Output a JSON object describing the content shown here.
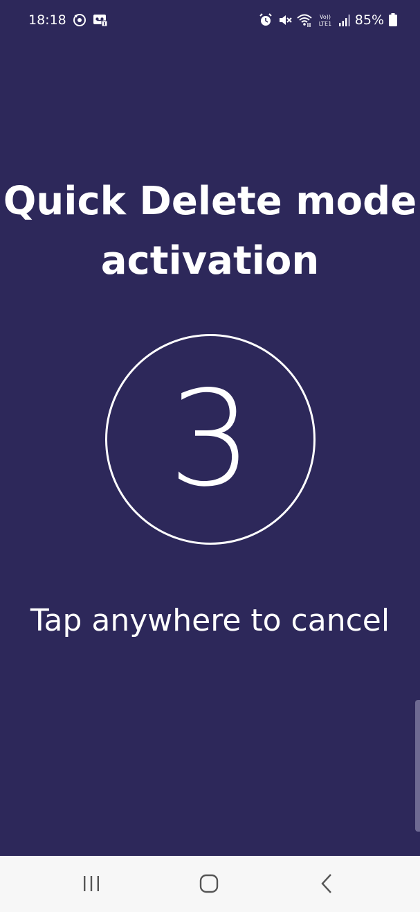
{
  "status_bar": {
    "time": "18:18",
    "battery_percent": "85%",
    "network_label_top": "Vo))",
    "network_label_bottom": "LTE1",
    "icons_left": [
      "sync-icon",
      "voicemail-icon"
    ],
    "icons_right": [
      "alarm-icon",
      "mute-icon",
      "wifi-icon",
      "volte-icon",
      "signal-icon",
      "battery-icon"
    ]
  },
  "main": {
    "title": "Quick Delete mode activation",
    "countdown": "3",
    "cancel_hint": "Tap anywhere to cancel"
  },
  "nav_bar": {
    "buttons": [
      "recents",
      "home",
      "back"
    ]
  },
  "colors": {
    "background": "#2d285a",
    "text": "#ffffff",
    "nav_background": "#f7f7f7",
    "nav_icon": "#555555"
  }
}
